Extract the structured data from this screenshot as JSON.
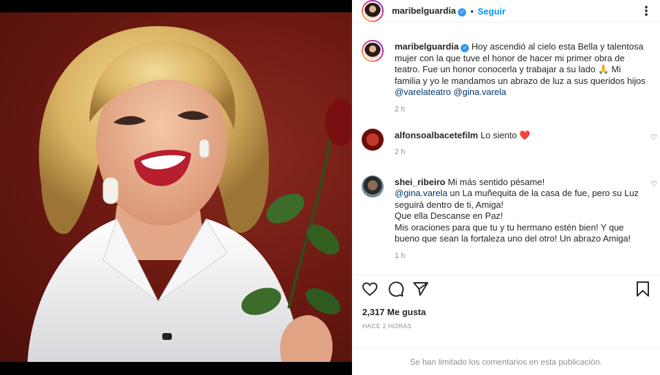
{
  "header": {
    "username": "maribelguardia",
    "verified_mark": "✓",
    "separator": "•",
    "follow_label": "Seguir",
    "more_label": "⋮"
  },
  "post": {
    "username": "maribelguardia",
    "caption": " Hoy ascendió al cielo esta Bella y talentosa mujer con la que tuve el honor de hacer mi primer obra de teatro. Fue un honor conocerla y trabajar a su lado 🙏 Mi familia y yo le mandamos un abrazo de luz a sus queridos hijos ",
    "mention1": "@varelateatro",
    "mention2": "@gina.varela",
    "time": "2 h"
  },
  "comments": [
    {
      "username": "alfonsoalbacetefilm",
      "text": " Lo siento ",
      "emoji": "❤️",
      "time": "2 h"
    },
    {
      "username": "shei_ribeiro",
      "line1": " Mi más sentido pésame!",
      "mention": "@gina.varela",
      "line2": " un La muñequita de la casa de fue, pero su Luz seguirá dentro de ti, Amiga!",
      "line3": "Que ella Descanse en Paz!",
      "line4": "Mis oraciones para que tu y tu hermano estén bien! Y que bueno que sean la fortaleza uno del otro! Un abrazo Amiga!",
      "time": "1 h"
    }
  ],
  "actions": {
    "like_icon": "heart-outline-icon",
    "comment_icon": "comment-icon",
    "share_icon": "paper-plane-icon",
    "save_icon": "bookmark-icon"
  },
  "likes": "2,317 Me gusta",
  "posted_ago": "HACE 2 HORAS",
  "comments_limited": "Se han limitado los comentarios en esta publicación.",
  "colors": {
    "link": "#0095f6",
    "mention": "#00376b",
    "muted": "#8e8e8e",
    "heart": "#ed4956"
  }
}
